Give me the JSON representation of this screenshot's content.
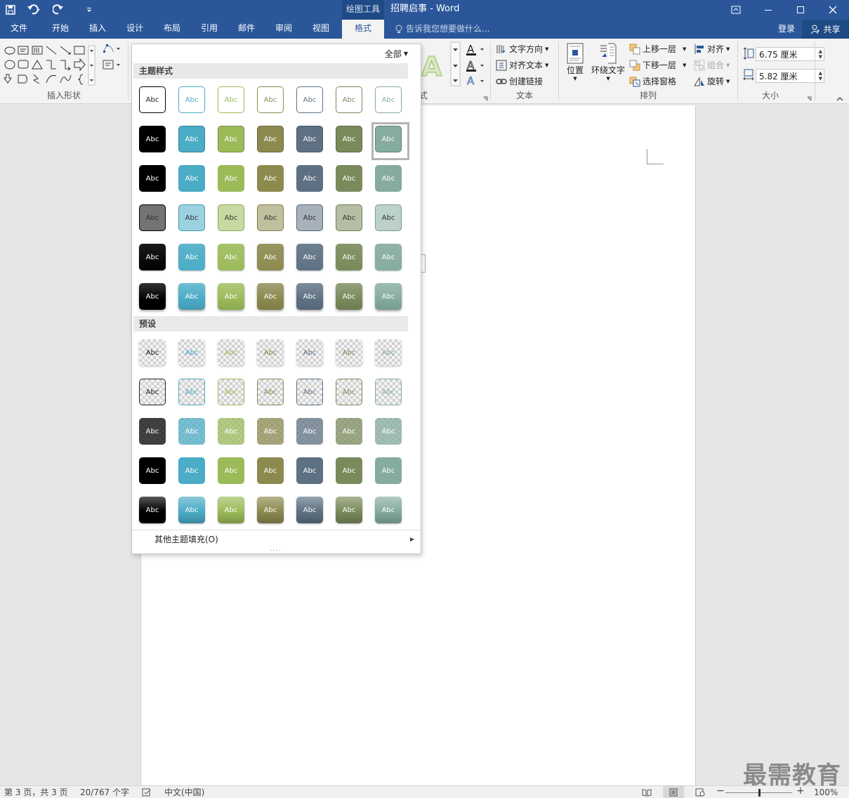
{
  "title_bar": {
    "context_tool": "绘图工具",
    "document_title": "招聘启事 - Word"
  },
  "tabs": [
    {
      "label": "文件",
      "active": false
    },
    {
      "label": "开始",
      "active": false
    },
    {
      "label": "插入",
      "active": false
    },
    {
      "label": "设计",
      "active": false
    },
    {
      "label": "布局",
      "active": false
    },
    {
      "label": "引用",
      "active": false
    },
    {
      "label": "邮件",
      "active": false
    },
    {
      "label": "审阅",
      "active": false
    },
    {
      "label": "视图",
      "active": false
    },
    {
      "label": "格式",
      "active": true
    }
  ],
  "tell_me": "告诉我您想要做什么...",
  "account": {
    "login": "登录",
    "share": "共享"
  },
  "ribbon": {
    "insert_shapes_label": "插入形状",
    "wordart_partial": "式",
    "text_group": {
      "label": "文本",
      "text_direction": "文字方向",
      "align_text": "对齐文本",
      "create_link": "创建链接"
    },
    "arrange_group": {
      "label": "排列",
      "position": "位置",
      "wrap_text": "环绕文字",
      "bring_forward": "上移一层",
      "send_backward": "下移一层",
      "selection_pane": "选择窗格",
      "align": "对齐",
      "group": "组合",
      "rotate": "旋转"
    },
    "size_group": {
      "label": "大小",
      "height": "6.75 厘米",
      "width": "5.82 厘米"
    }
  },
  "gallery": {
    "filter_label": "全部",
    "theme_section": "主题样式",
    "preset_section": "预设",
    "swatch_text": "Abc",
    "more_fills": "其他主题填充(O)",
    "colors": [
      "#000000",
      "#4bacc6",
      "#9bbb59",
      "#8c8a4f",
      "#5e7183",
      "#7a8a5b",
      "#85ac9d"
    ],
    "selected": {
      "row": 1,
      "col": 6
    }
  },
  "status": {
    "page": "第 3 页，共 3 页",
    "words": "20/767 个字",
    "language": "中文(中国)",
    "zoom": "100%"
  },
  "watermark": "最需教育"
}
